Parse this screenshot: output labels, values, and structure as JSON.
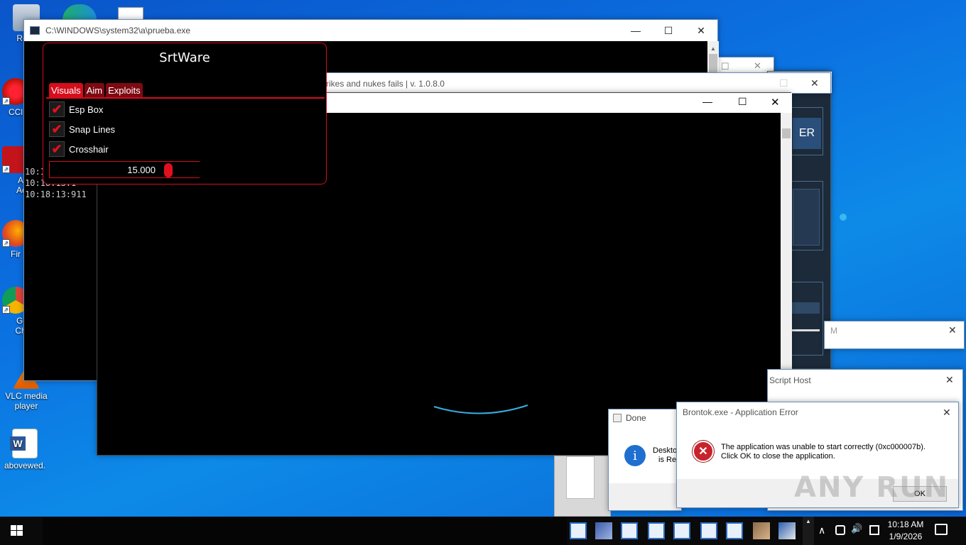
{
  "desktop": {
    "icons": [
      {
        "label": "Recy",
        "name": "recycle-bin-icon"
      },
      {
        "label": "CCl",
        "name": "ccleaner-icon"
      },
      {
        "label": "Ac Acr",
        "name": "acrobat-icon"
      },
      {
        "label": "Fir",
        "name": "firefox-icon"
      },
      {
        "label": "Go Chr",
        "name": "chrome-icon"
      },
      {
        "label": "VLC media player",
        "name": "vlc-icon"
      },
      {
        "label": "abovewed.",
        "name": "word-doc-icon"
      }
    ]
  },
  "console": {
    "title": "C:\\WINDOWS\\system32\\a\\prueba.exe",
    "lines": [
      "10:1",
      "10:18:13:1",
      "10:18:13:911"
    ]
  },
  "srtware": {
    "title": "SrtWare",
    "tabs": [
      "Visuals",
      "Aim",
      "Exploits"
    ],
    "options": [
      "Esp Box",
      "Snap Lines",
      "Crosshair"
    ],
    "check_mark": "✔",
    "slider_value": "15.000"
  },
  "game_window": {
    "title": "rikes and nukes fails | v. 1.0.8.0"
  },
  "right_panel": {
    "button_text": "ER"
  },
  "partial_windows": {
    "m_title": "M",
    "script_host_title": "Script Host"
  },
  "done_dialog": {
    "title": "Done",
    "text_line1": "Deskto",
    "text_line2": "is Re"
  },
  "error_dialog": {
    "title": "Brontok.exe - Application Error",
    "message_line1": "The application was unable to start correctly (0xc000007b).",
    "message_line2": "Click OK to close the application.",
    "ok_label": "OK"
  },
  "watermark": "ANY RUN",
  "taskbar": {
    "time": "10:18 AM",
    "date": "1/9/2026"
  },
  "glyphs": {
    "minimize": "—",
    "maximize": "☐",
    "close": "✕",
    "info": "i",
    "error": "✕",
    "chevron_up": "∧",
    "chevron_small": "▲",
    "speaker": "🔊",
    "notification": "🗨"
  }
}
